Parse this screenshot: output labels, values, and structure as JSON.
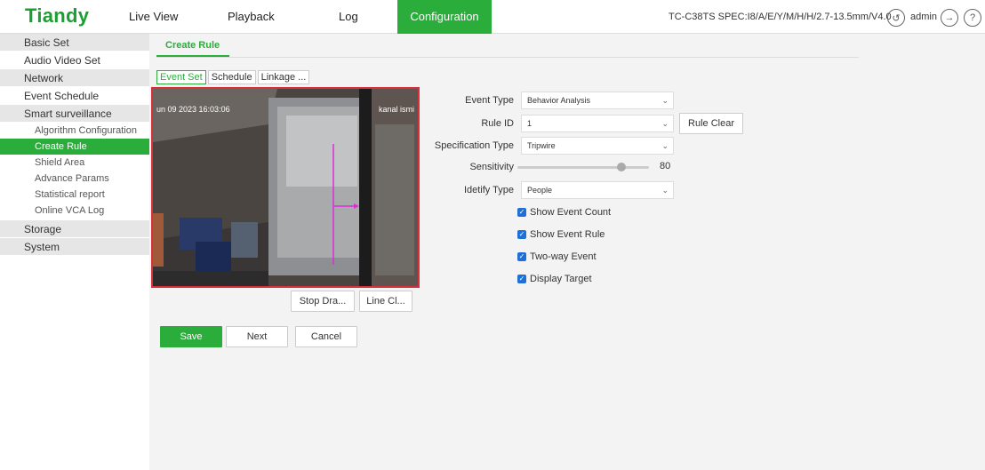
{
  "header": {
    "logo": "Tiandy",
    "nav": [
      {
        "label": "Live View"
      },
      {
        "label": "Playback"
      },
      {
        "label": "Log"
      },
      {
        "label": "Configuration"
      }
    ],
    "device_info": "TC-C38TS SPEC:I8/A/E/Y/M/H/H/2.7-13.5mm/V4.0",
    "user": "admin",
    "icons": [
      "user-switch-icon",
      "logout-icon",
      "help-icon"
    ]
  },
  "sidebar": {
    "items": [
      {
        "label": "Basic Set"
      },
      {
        "label": "Audio Video Set"
      },
      {
        "label": "Network"
      },
      {
        "label": "Event Schedule"
      },
      {
        "label": "Smart surveillance"
      }
    ],
    "subitems": [
      {
        "label": "Algorithm Configuration"
      },
      {
        "label": "Create Rule"
      },
      {
        "label": "Shield Area"
      },
      {
        "label": "Advance Params"
      },
      {
        "label": "Statistical report"
      },
      {
        "label": "Online VCA Log"
      }
    ],
    "bottom_items": [
      {
        "label": "Storage"
      },
      {
        "label": "System"
      }
    ]
  },
  "main": {
    "page_tab": "Create Rule",
    "subtabs": [
      {
        "label": "Event Set"
      },
      {
        "label": "Schedule"
      },
      {
        "label": "Linkage ..."
      }
    ],
    "video": {
      "timestamp": "un 09 2023 16:03:06",
      "camera_name": "kanal ismi"
    },
    "draw_buttons": {
      "stop_draw": "Stop Dra...",
      "line_clear": "Line Cl..."
    },
    "form": {
      "event_type_label": "Event Type",
      "event_type_value": "Behavior Analysis",
      "rule_id_label": "Rule ID",
      "rule_id_value": "1",
      "rule_clear": "Rule Clear",
      "spec_type_label": "Specification Type",
      "spec_type_value": "Tripwire",
      "sensitivity_label": "Sensitivity",
      "sensitivity_value": "80",
      "identify_type_label": "Idetify Type",
      "identify_type_value": "People",
      "checkboxes": [
        {
          "label": "Show Event Count",
          "checked": true
        },
        {
          "label": "Show Event Rule",
          "checked": true
        },
        {
          "label": "Two-way Event",
          "checked": true
        },
        {
          "label": "Display Target",
          "checked": true
        }
      ]
    },
    "actions": {
      "save": "Save",
      "next": "Next",
      "cancel": "Cancel"
    }
  },
  "colors": {
    "accent": "#2aad3a",
    "highlight_border": "#d6303a",
    "checkbox": "#1e6fd8",
    "tripwire": "#d82fd8"
  }
}
